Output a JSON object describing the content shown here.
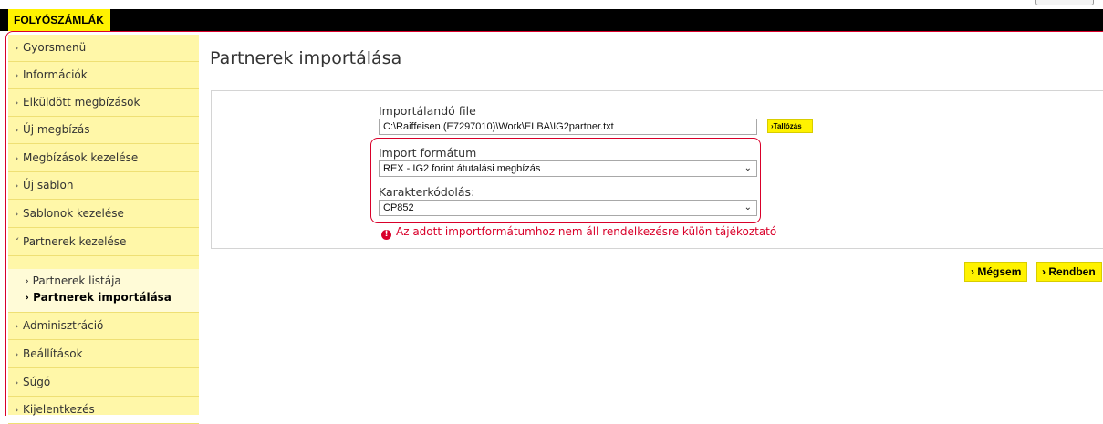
{
  "app": {
    "title": "FOLYÓSZÁMLÁK"
  },
  "sidebar": {
    "items": [
      {
        "label": "Gyorsmenü"
      },
      {
        "label": "Információk"
      },
      {
        "label": "Elküldött megbízások"
      },
      {
        "label": "Új megbízás"
      },
      {
        "label": "Megbízások kezelése"
      },
      {
        "label": "Új sablon"
      },
      {
        "label": "Sablonok kezelése"
      },
      {
        "label": "Partnerek kezelése",
        "expanded": true
      },
      {
        "label": "Adminisztráció"
      },
      {
        "label": "Beállítások"
      },
      {
        "label": "Súgó"
      },
      {
        "label": "Kijelentkezés"
      }
    ],
    "subitems": [
      {
        "label": "Partnerek listája",
        "active": false
      },
      {
        "label": "Partnerek importálása",
        "active": true
      }
    ]
  },
  "page": {
    "title": "Partnerek importálása"
  },
  "form": {
    "file_label": "Importálandó file",
    "file_value": "C:\\Raiffeisen (E7297010)\\Work\\ELBA\\IG2partner.txt",
    "browse_label": "Tallózás",
    "format_label": "Import formátum",
    "format_value": "REX - IG2 forint átutalási megbízás",
    "encoding_label": "Karakterkódolás:",
    "encoding_value": "CP852",
    "warning": "Az adott importformátumhoz nem áll rendelkezésre külön tájékoztató"
  },
  "actions": {
    "cancel_label": "Mégsem",
    "ok_label": "Rendben"
  },
  "colors": {
    "accent_yellow": "#fff200",
    "sidebar_bg": "#fff7a8",
    "alert_red": "#d9002a",
    "appbar": "#000000"
  },
  "icons": {
    "menu_chevron": "chevron-right-icon",
    "expanded_chevron": "chevron-down-icon",
    "warning": "warning-icon"
  }
}
